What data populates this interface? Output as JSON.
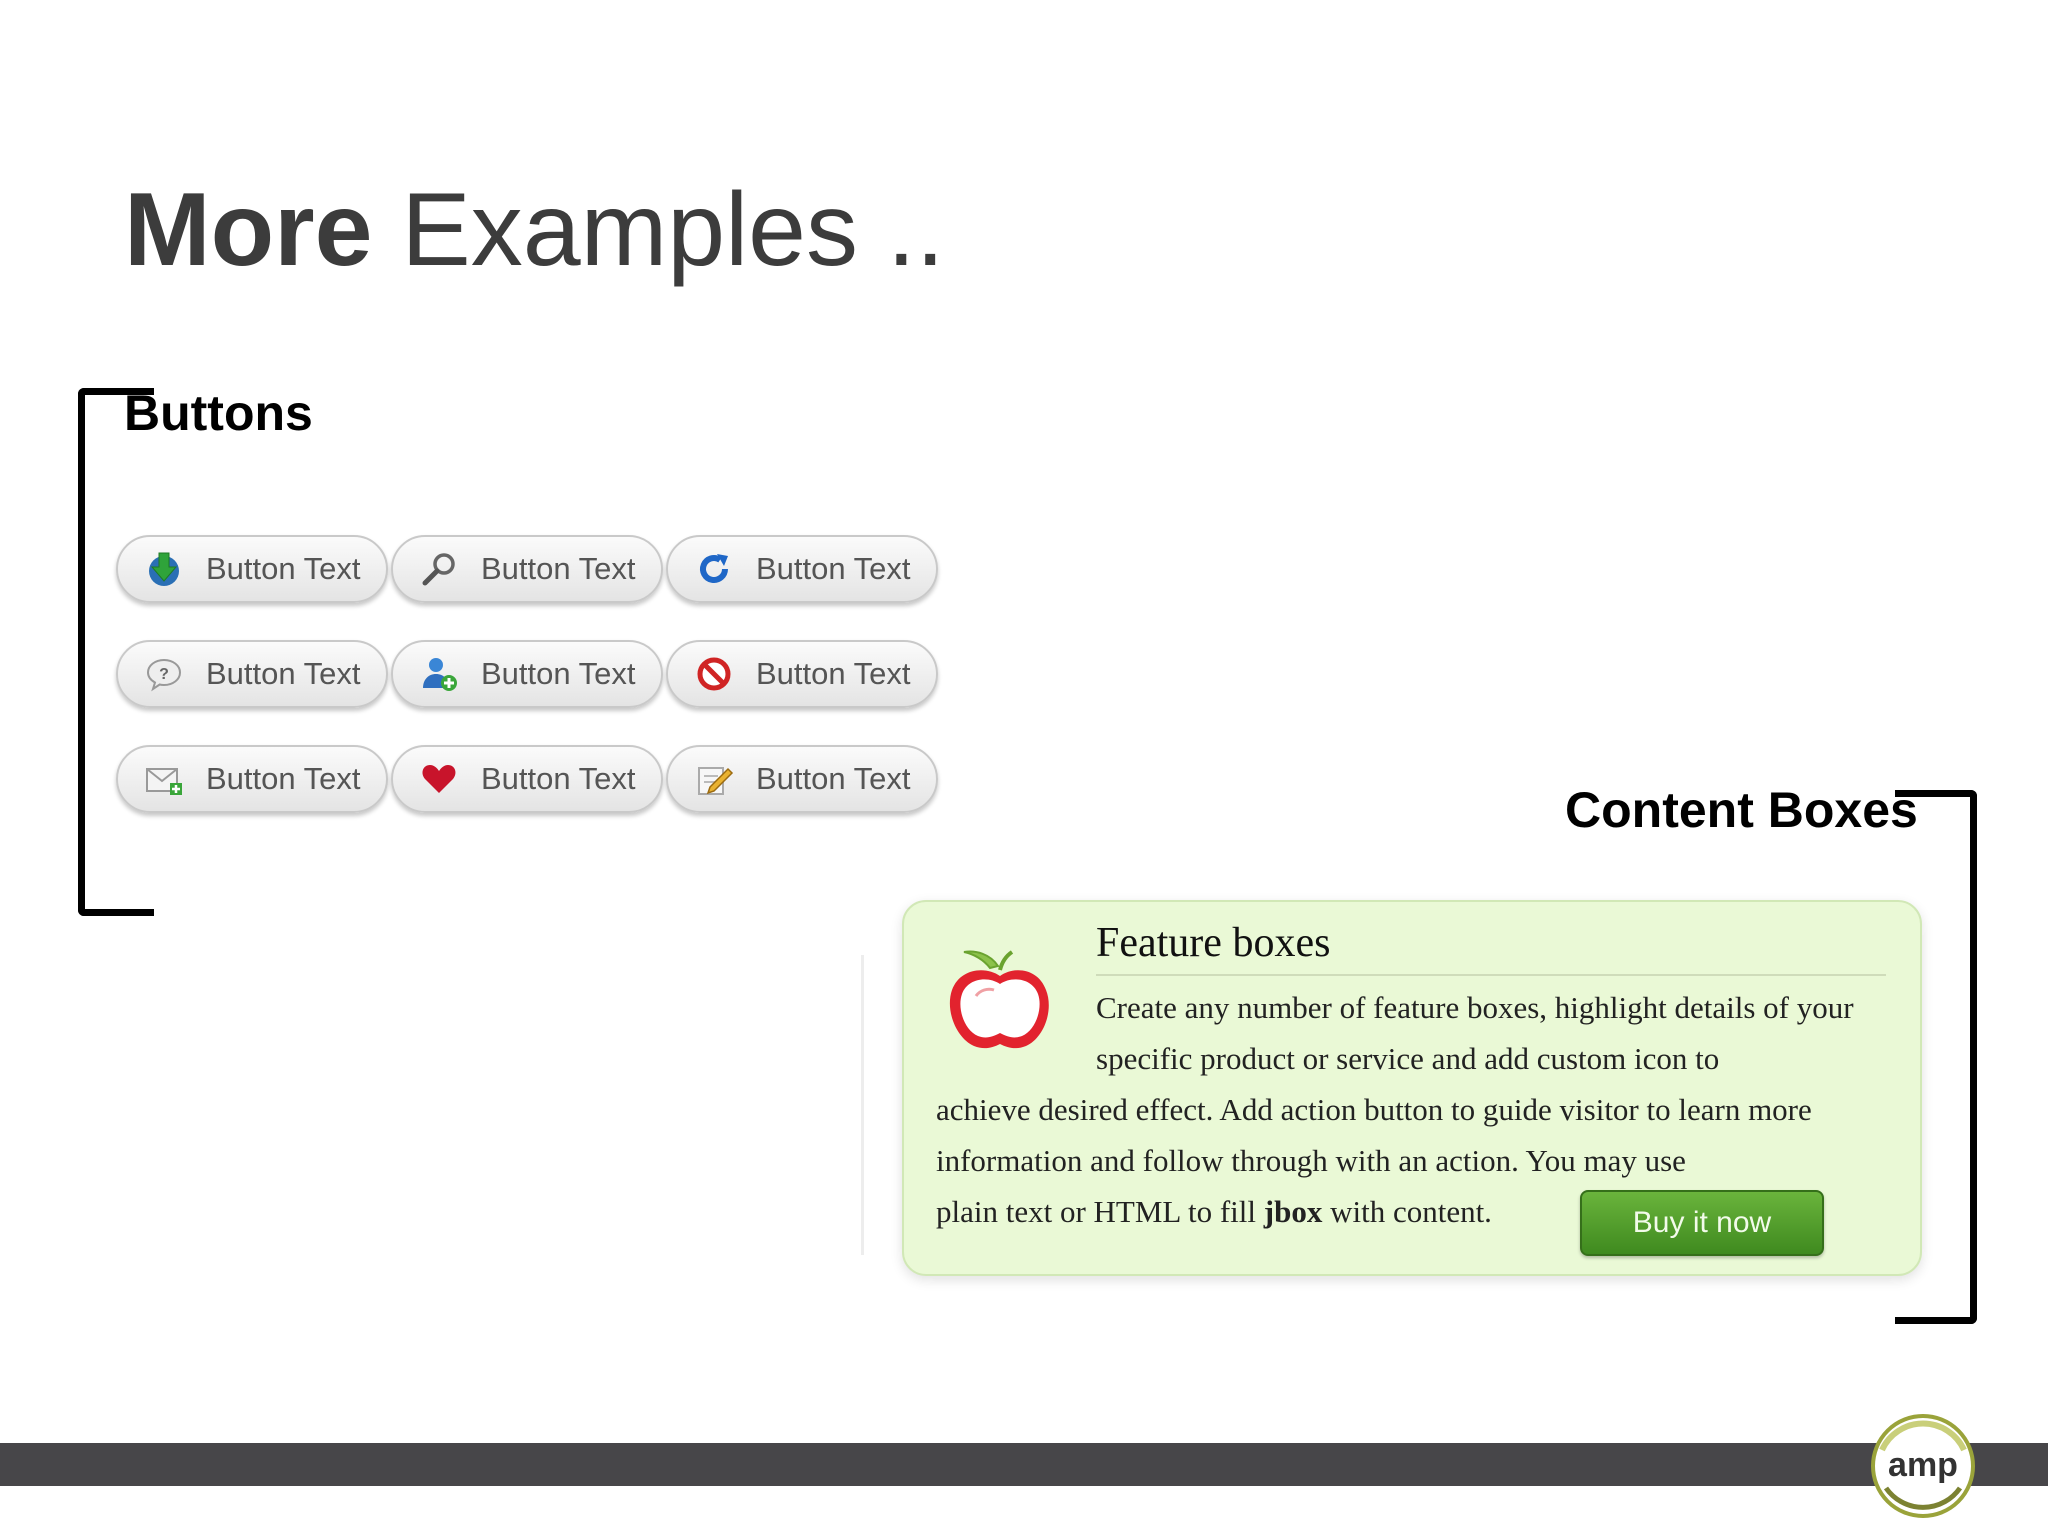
{
  "slide": {
    "title_bold": "More",
    "title_rest": "Examples .."
  },
  "buttons_section": {
    "label": "Buttons",
    "items": [
      {
        "label": "Button Text",
        "icon": "download-icon"
      },
      {
        "label": "Button Text",
        "icon": "search-icon"
      },
      {
        "label": "Button Text",
        "icon": "refresh-icon"
      },
      {
        "label": "Button Text",
        "icon": "help-icon"
      },
      {
        "label": "Button Text",
        "icon": "add-user-icon"
      },
      {
        "label": "Button Text",
        "icon": "block-icon"
      },
      {
        "label": "Button Text",
        "icon": "mail-add-icon"
      },
      {
        "label": "Button Text",
        "icon": "heart-icon"
      },
      {
        "label": "Button Text",
        "icon": "edit-icon"
      }
    ]
  },
  "content_section": {
    "label": "Content Boxes",
    "feature_box": {
      "heading": "Feature boxes",
      "text_line1": "Create any number of feature boxes, highlight details of your specific product or service and add custom icon to",
      "text_line2": "achieve desired effect. Add action button to guide visitor to learn more information and follow through with an action. You may use",
      "text_pre": "plain text or HTML to fill",
      "text_bold": "jbox",
      "text_post": "with content.",
      "button_label": "Buy it now",
      "icon": "apple-icon"
    }
  },
  "footer": {
    "logo_text": "amp"
  },
  "colors": {
    "title": "#3c3c3c",
    "feature_bg": "#eaf9d6",
    "buy_button": "#4f9a2a",
    "footer_bar": "#474649"
  }
}
